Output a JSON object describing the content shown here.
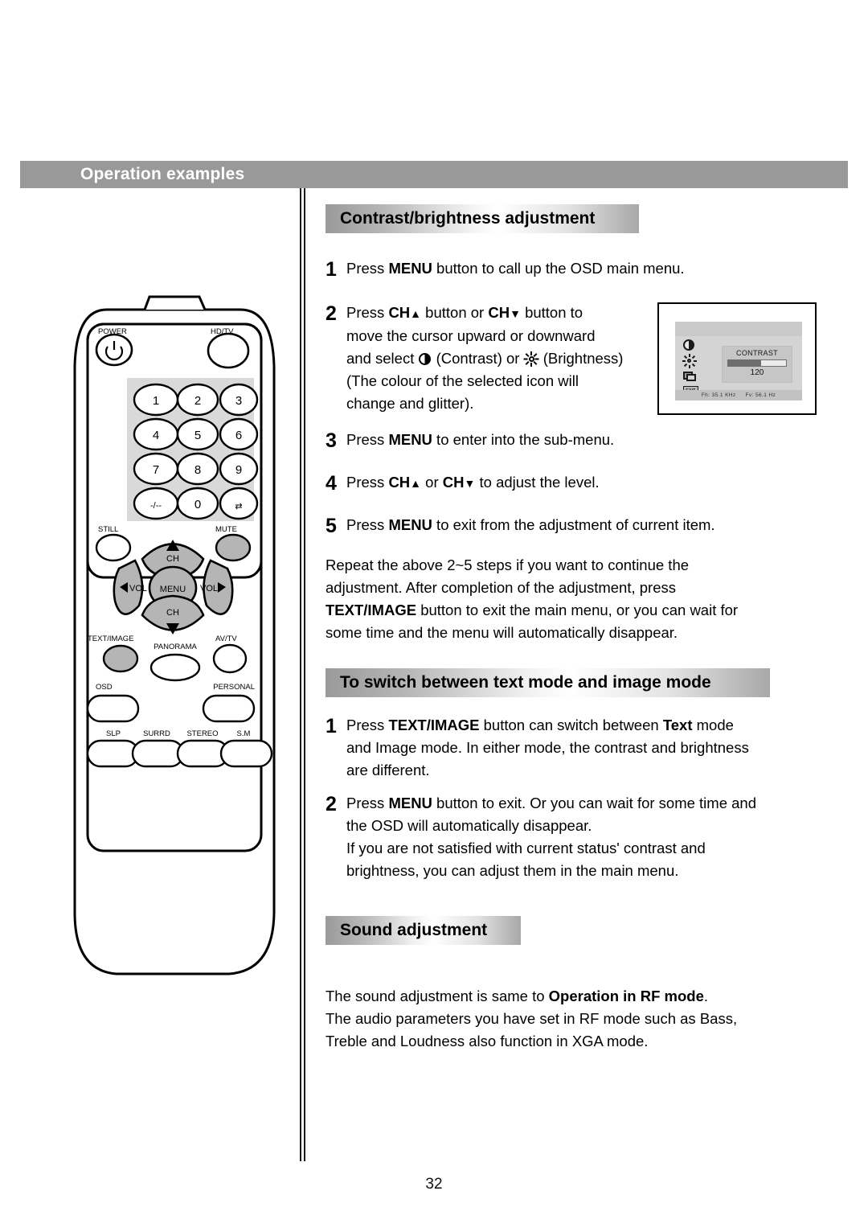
{
  "page": {
    "number": "32",
    "banner_title": "Operation examples",
    "banner_color": "#999999"
  },
  "sections": {
    "contrast": {
      "heading": "Contrast/brightness adjustment",
      "steps": [
        {
          "num": "1",
          "text_a": "Press ",
          "bold_a": "MENU",
          "text_b": " button to call up the OSD main menu."
        },
        {
          "num": "2",
          "line2": "move the cursor upward or downward",
          "line3a": "and select ",
          "line3b": " (Contrast) or ",
          "line3c": " (Brightness)",
          "line4": "(The colour of the selected icon will",
          "line5": "change and glitter)."
        },
        {
          "num": "3",
          "text_a": "Press ",
          "bold_a": "MENU",
          "text_b": " to enter into the sub-menu."
        },
        {
          "num": "4",
          "text_a": "Press ",
          "bold_a": "CH",
          "arrow_a": "▲",
          "text_b": " or ",
          "bold_b": "CH",
          "arrow_b": "▼",
          "text_c": " to adjust the level."
        },
        {
          "num": "5",
          "text_a": "Press ",
          "bold_a": "MENU",
          "text_b": " to exit from the adjustment of current item."
        }
      ],
      "step2_prefix": "Press ",
      "step2_bold1": "CH",
      "step2_arrow1": "▲",
      "step2_mid": " button or ",
      "step2_bold2": "CH",
      "step2_arrow2": "▼",
      "step2_suffix": " button to",
      "paragraph": {
        "line1": "Repeat the above 2~5 steps if you want to continue the",
        "line2": "adjustment. After completion of the adjustment, press",
        "line3_bold": "TEXT/IMAGE",
        "line3_rest": " button to exit the main menu, or you can wait for",
        "line4": "some time and the menu will automatically disappear."
      }
    },
    "textimage": {
      "heading": "To switch between text mode and image mode",
      "step1": {
        "num": "1",
        "a": "Press ",
        "b1": "TEXT/IMAGE",
        "c": " button can switch between ",
        "b2": "Text",
        "d": " mode",
        "line2": "and Image mode. In either mode, the contrast and brightness",
        "line3": "are different."
      },
      "step2": {
        "num": "2",
        "a": "Press ",
        "b1": "MENU",
        "c": " button to exit. Or you can wait for some time and",
        "line2": "the OSD will automatically disappear.",
        "line3": "If you are not satisfied with current status' contrast and",
        "line4": "brightness, you can adjust them in the main menu."
      }
    },
    "sound": {
      "heading": "Sound adjustment",
      "line1a": "The sound adjustment is same to ",
      "line1b": "Operation in RF mode",
      "line1c": ".",
      "line2": "The audio parameters you have set in RF mode such as Bass,",
      "line3": "Treble and Loudness also function in XGA mode."
    }
  },
  "osd": {
    "menu_title": "CONTRAST",
    "value": "120",
    "fill_percent": 57,
    "icons": [
      "contrast-icon",
      "brightness-icon",
      "recall-icon",
      "exit-icon"
    ],
    "exit_label": "EXIT",
    "status_fh_label": "Fh:",
    "status_fh_value": "35.1 KHz",
    "status_fv_label": "Fv:",
    "status_fv_value": "56.1 Hz"
  },
  "remote": {
    "power_label": "POWER",
    "hdtv_label": "HD/TV",
    "keypad": [
      "1",
      "2",
      "3",
      "4",
      "5",
      "6",
      "7",
      "8",
      "9",
      "-/--",
      "0",
      "⇄"
    ],
    "still_label": "STILL",
    "mute_label": "MUTE",
    "ch_up_label": "CH",
    "ch_down_label": "CH",
    "vol_left_label": "VOL",
    "vol_right_label": "VOL",
    "menu_label": "MENU",
    "textimage_label": "TEXT/IMAGE",
    "avtv_label": "AV/TV",
    "panorama_label": "PANORAMA",
    "osd_label": "OSD",
    "personal_label": "PERSONAL",
    "slp_label": "SLP",
    "surrd_label": "SURRD",
    "stereo_label": "STEREO",
    "sm_label": "S.M"
  }
}
